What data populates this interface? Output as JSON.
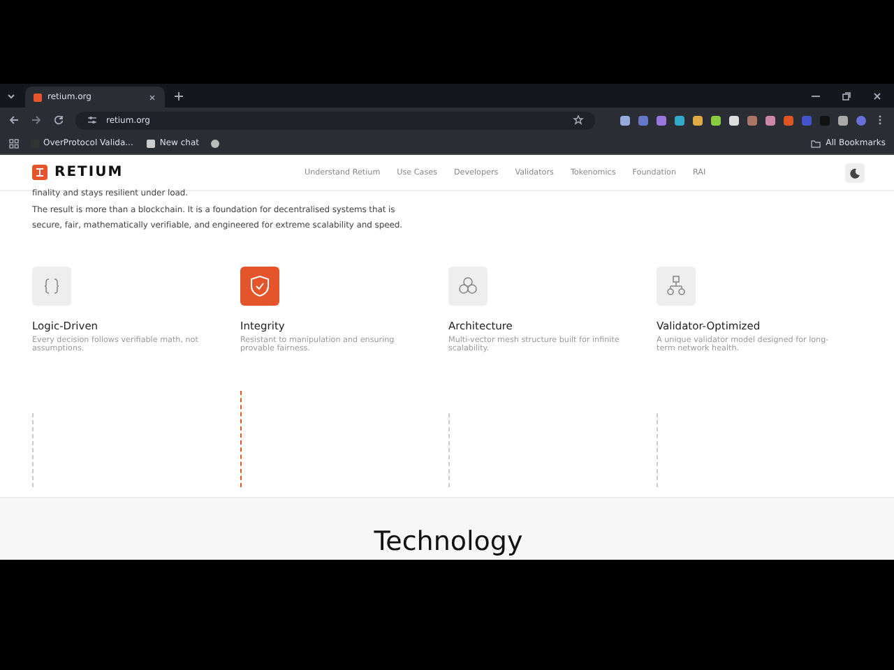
{
  "browser": {
    "tab_title": "retium.org",
    "url": "retium.org",
    "bookmarks": [
      "OverProtocol Valida...",
      "New chat"
    ],
    "all_bookmarks": "All Bookmarks"
  },
  "site_header": {
    "logo": "RETIUM",
    "nav": [
      "Understand Retium",
      "Use Cases",
      "Developers",
      "Validators",
      "Tokenomics",
      "Foundation",
      "RAI"
    ]
  },
  "intro": [
    "finality and stays resilient under load.",
    "The result is more than a blockchain. It is a foundation for decentralised systems that is secure, fair, mathematically verifiable, and engineered for extreme scalability and speed."
  ],
  "features": [
    {
      "kind": "braces",
      "title": "Logic-Driven",
      "description": "Every decision follows verifiable math, not assumptions.",
      "selected": false
    },
    {
      "kind": "shield",
      "title": "Integrity",
      "description": "Resistant to manipulation and ensuring provable fairness.",
      "selected": true
    },
    {
      "kind": "hexagons",
      "title": "Architecture",
      "description": "Multi-vector mesh structure built for infinite scalability.",
      "selected": false
    },
    {
      "kind": "hierarchy",
      "title": "Validator-Optimized",
      "description": "A unique validator model designed for long-term network health.",
      "selected": false
    }
  ],
  "section_heading": "Technology"
}
